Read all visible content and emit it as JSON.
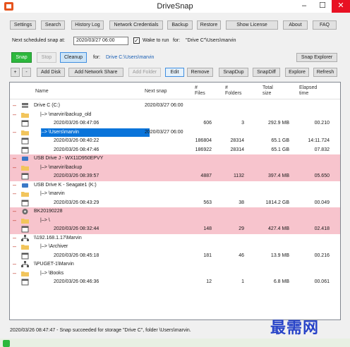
{
  "window": {
    "title": "DriveSnap",
    "minimize": "–",
    "maximize": "☐",
    "close": "✕"
  },
  "toolbar": [
    "Settings",
    "Search",
    "History Log",
    "Network Credentials",
    "Backup",
    "Restore",
    "Show License",
    "About",
    "FAQ"
  ],
  "schedule": {
    "label": "Next scheduled snap at:",
    "value": "2020/03/27 06:00",
    "wake_checked": true,
    "wake_label": "Wake to run",
    "for_label": "for:",
    "for_value": "\"Drive C\"\\Users\\marvin"
  },
  "actions": {
    "snap": "Snap",
    "stop": "Stop",
    "cleanup": "Cleanup",
    "for_label": "for:",
    "for_value": "Drive C:\\Users\\marvin",
    "snap_explorer": "Snap Explorer"
  },
  "buttons2": {
    "plus": "+",
    "minus": "-",
    "add_disk": "Add Disk",
    "add_network": "Add Network Share",
    "add_folder": "Add Folder",
    "edit": "Edit",
    "remove": "Remove",
    "snapdup": "SnapDup",
    "snapdiff": "SnapDiff",
    "explore": "Explore",
    "refresh": "Refresh"
  },
  "columns": {
    "name": "Name",
    "next_snap": "Next snap",
    "files_1": "#",
    "files_2": "Files",
    "folders_1": "#",
    "folders_2": "Folders",
    "size_1": "Total",
    "size_2": "size",
    "elapsed_1": "Elapsed",
    "elapsed_2": "time"
  },
  "rows": [
    {
      "type": "disk",
      "toggle": "–",
      "name": "Drive C (C:)",
      "next": "2020/03/27 06:00",
      "files": "",
      "folders": "",
      "size": "",
      "elapsed": "",
      "pink": false
    },
    {
      "type": "folder",
      "toggle": "–",
      "name": "|–> \\marvin\\backup_old",
      "next": "",
      "files": "",
      "folders": "",
      "size": "",
      "elapsed": "",
      "pink": false
    },
    {
      "type": "snap",
      "toggle": "",
      "name": "2020/03/26 08:47:06",
      "next": "",
      "files": "606",
      "folders": "3",
      "size": "292.9 MB",
      "elapsed": "00.210",
      "pink": false
    },
    {
      "type": "folder",
      "toggle": "–",
      "name": "|–> \\Users\\marvin",
      "next": "2020/03/27 06:00",
      "files": "",
      "folders": "",
      "size": "",
      "elapsed": "",
      "pink": false,
      "selected": true
    },
    {
      "type": "snap",
      "toggle": "",
      "name": "2020/03/26 08:40:22",
      "next": "",
      "files": "186804",
      "folders": "28314",
      "size": "65.1 GB",
      "elapsed": "14:11.724",
      "pink": false
    },
    {
      "type": "snap",
      "toggle": "",
      "name": "2020/03/26 08:47:46",
      "next": "",
      "files": "186922",
      "folders": "28314",
      "size": "65.1 GB",
      "elapsed": "07.832",
      "pink": false
    },
    {
      "type": "usb",
      "toggle": "–",
      "name": "USB Drive J - WX11D950EPVY",
      "next": "",
      "files": "",
      "folders": "",
      "size": "",
      "elapsed": "",
      "pink": true
    },
    {
      "type": "folder",
      "toggle": "–",
      "name": "|–> \\marvin\\backup",
      "next": "",
      "files": "",
      "folders": "",
      "size": "",
      "elapsed": "",
      "pink": true
    },
    {
      "type": "snap",
      "toggle": "",
      "name": "2020/03/26 08:39:57",
      "next": "",
      "files": "4887",
      "folders": "1132",
      "size": "397.4 MB",
      "elapsed": "05.650",
      "pink": true
    },
    {
      "type": "usb",
      "toggle": "–",
      "name": "USB Drive K - Seagate1 (K:)",
      "next": "",
      "files": "",
      "folders": "",
      "size": "",
      "elapsed": "",
      "pink": false
    },
    {
      "type": "folder",
      "toggle": "–",
      "name": "|–> \\marvin",
      "next": "",
      "files": "",
      "folders": "",
      "size": "",
      "elapsed": "",
      "pink": false
    },
    {
      "type": "snap",
      "toggle": "",
      "name": "2020/03/26 08:43:29",
      "next": "",
      "files": "563",
      "folders": "38",
      "size": "1814.2 GB",
      "elapsed": "00.049",
      "pink": false
    },
    {
      "type": "bk",
      "toggle": "–",
      "name": "BK20190228",
      "next": "",
      "files": "",
      "folders": "",
      "size": "",
      "elapsed": "",
      "pink": true
    },
    {
      "type": "folder",
      "toggle": "–",
      "name": "|–> \\",
      "next": "",
      "files": "",
      "folders": "",
      "size": "",
      "elapsed": "",
      "pink": true
    },
    {
      "type": "snap",
      "toggle": "",
      "name": "2020/03/26 08:32:44",
      "next": "",
      "files": "148",
      "folders": "29",
      "size": "427.4 MB",
      "elapsed": "02.418",
      "pink": true
    },
    {
      "type": "network",
      "toggle": "–",
      "name": "\\\\192.168.1.17\\Marvin",
      "next": "",
      "files": "",
      "folders": "",
      "size": "",
      "elapsed": "",
      "pink": false
    },
    {
      "type": "folder",
      "toggle": "–",
      "name": "|–> \\Archiver",
      "next": "",
      "files": "",
      "folders": "",
      "size": "",
      "elapsed": "",
      "pink": false
    },
    {
      "type": "snap",
      "toggle": "",
      "name": "2020/03/26 08:45:18",
      "next": "",
      "files": "181",
      "folders": "46",
      "size": "13.9 MB",
      "elapsed": "00.216",
      "pink": false
    },
    {
      "type": "network",
      "toggle": "–",
      "name": "\\\\PUGET-1\\Marvin",
      "next": "",
      "files": "",
      "folders": "",
      "size": "",
      "elapsed": "",
      "pink": false
    },
    {
      "type": "folder",
      "toggle": "–",
      "name": "|–> \\Books",
      "next": "",
      "files": "",
      "folders": "",
      "size": "",
      "elapsed": "",
      "pink": false
    },
    {
      "type": "snap",
      "toggle": "",
      "name": "2020/03/26 08:46:36",
      "next": "",
      "files": "12",
      "folders": "1",
      "size": "6.8 MB",
      "elapsed": "00.061",
      "pink": false
    }
  ],
  "status": "2020/03/26 08:47:47 - Snap succeeded for storage \"Drive C\", folder \\Users\\marvin.",
  "watermark": "最需网",
  "colors": {
    "snap_green": "#2db83d",
    "pink_row": "#f7c4cd",
    "selection": "#0a74da",
    "close_red": "#e81123"
  }
}
